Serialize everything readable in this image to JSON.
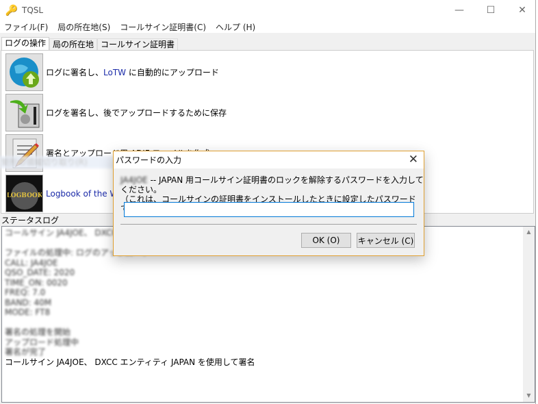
{
  "window": {
    "title": "TQSL"
  },
  "menu": [
    "ファイル(F)",
    "局の所在地(S)",
    "コールサイン証明書(C)",
    "ヘルプ (H)"
  ],
  "tabs": [
    "ログの操作",
    "局の所在地",
    "コールサイン証明書"
  ],
  "actions": {
    "sign_upload_pre": "ログに署名し、",
    "sign_upload_lotw": "LoTW",
    "sign_upload_post": " に自動的にアップロード",
    "sign_save": "ログを署名し、後でアップロードするために保存",
    "create_adif": "署名とアップロード用 ADIF ファイルを作成",
    "lotw_site": "Logbook of the W"
  },
  "ghost_menu": "矩形の領域切り取り(R)",
  "status_log": {
    "label": "ステータスログ",
    "blurred_lines": [
      "コールサイン JA4JOE、 DXCC",
      "",
      "ファイルの処理中: ログのアップロード",
      "CALL: JA4JOE",
      "QSO_DATE: 2020",
      "TIME_ON: 0020",
      "FREQ: 7.0",
      "BAND: 40M",
      "MODE: FT8",
      "",
      "署名の処理を開始",
      "アップロード処理中",
      "署名が完了"
    ],
    "last_line": "コールサイン  JA4JOE、  DXCC  エンティティ  JAPAN  を使用して署名"
  },
  "dialog": {
    "title": "パスワードの入力",
    "line1_blurred": "JA4JOE",
    "line1": " -- JAPAN 用コールサイン証明書のロックを解除するパスワードを入力してください。",
    "line2": "（これは、コールサインの証明書をインストールしたときに設定したパスワードです。）",
    "password_value": "",
    "ok_label": "OK (O)",
    "cancel_label": "キャンセル (C)"
  }
}
